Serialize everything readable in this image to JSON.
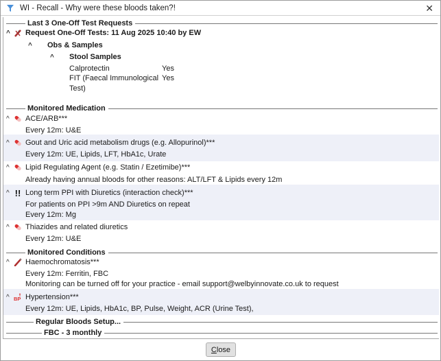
{
  "window": {
    "title": "WI - Recall - Why were these bloods taken?!",
    "close_glyph": "✕"
  },
  "sections": {
    "last_requests": {
      "title": "Last 3 One-Off Test Requests",
      "request": "Request One-Off Tests: 11 Aug 2025 10:40 by EW",
      "group": "Obs & Samples",
      "subgroup": "Stool Samples",
      "items": [
        {
          "name": "Calprotectin",
          "value": "Yes"
        },
        {
          "name": "FIT (Faecal Immunological",
          "name2": "Test)",
          "value": "Yes"
        }
      ]
    },
    "medication": {
      "title": "Monitored Medication",
      "items": [
        {
          "icon": "pill-icon",
          "title": "ACE/ARB***",
          "lines": [
            "Every 12m: U&E"
          ]
        },
        {
          "icon": "pill-icon",
          "title": "Gout and Uric acid metabolism drugs (e.g. Allopurinol)***",
          "lines": [
            "Every 12m: UE, Lipids, LFT, HbA1c, Urate"
          ]
        },
        {
          "icon": "pill-icon",
          "title": "Lipid Regulating Agent (e.g. Statin / Ezetimibe)***",
          "lines": [
            "Already having annual bloods for other reasons: ALT/LFT & Lipids every 12m"
          ]
        },
        {
          "icon": "double-exclamation-icon",
          "title": "Long term PPI with Diuretics (interaction check)***",
          "lines": [
            "For patients on PPI >9m AND Diuretics on repeat",
            "Every 12m: Mg"
          ]
        },
        {
          "icon": "pill-icon",
          "title": "Thiazides and related diuretics",
          "lines": [
            "Every 12m: U&E"
          ]
        }
      ]
    },
    "conditions": {
      "title": "Monitored Conditions",
      "items": [
        {
          "icon": "blood-tube-icon",
          "title": "Haemochromatosis***",
          "lines": [
            "Every 12m: Ferritin, FBC",
            "Monitoring can be turned off for your practice - email support@welbyinnovate.co.uk to request"
          ]
        },
        {
          "icon": "bp-icon",
          "title": "Hypertension***",
          "lines": [
            "Every 12m: UE, Lipids, HbA1c, BP, Pulse, Weight, ACR (Urine Test),"
          ]
        }
      ]
    },
    "regular": {
      "title": "Regular Bloods Setup...",
      "sub": "FBC - 3 monthly"
    }
  },
  "footer": {
    "close_first": "C",
    "close_rest": "lose"
  },
  "colors": {
    "accent_row": "#eef0f8",
    "icon_red": "#c0392b"
  }
}
